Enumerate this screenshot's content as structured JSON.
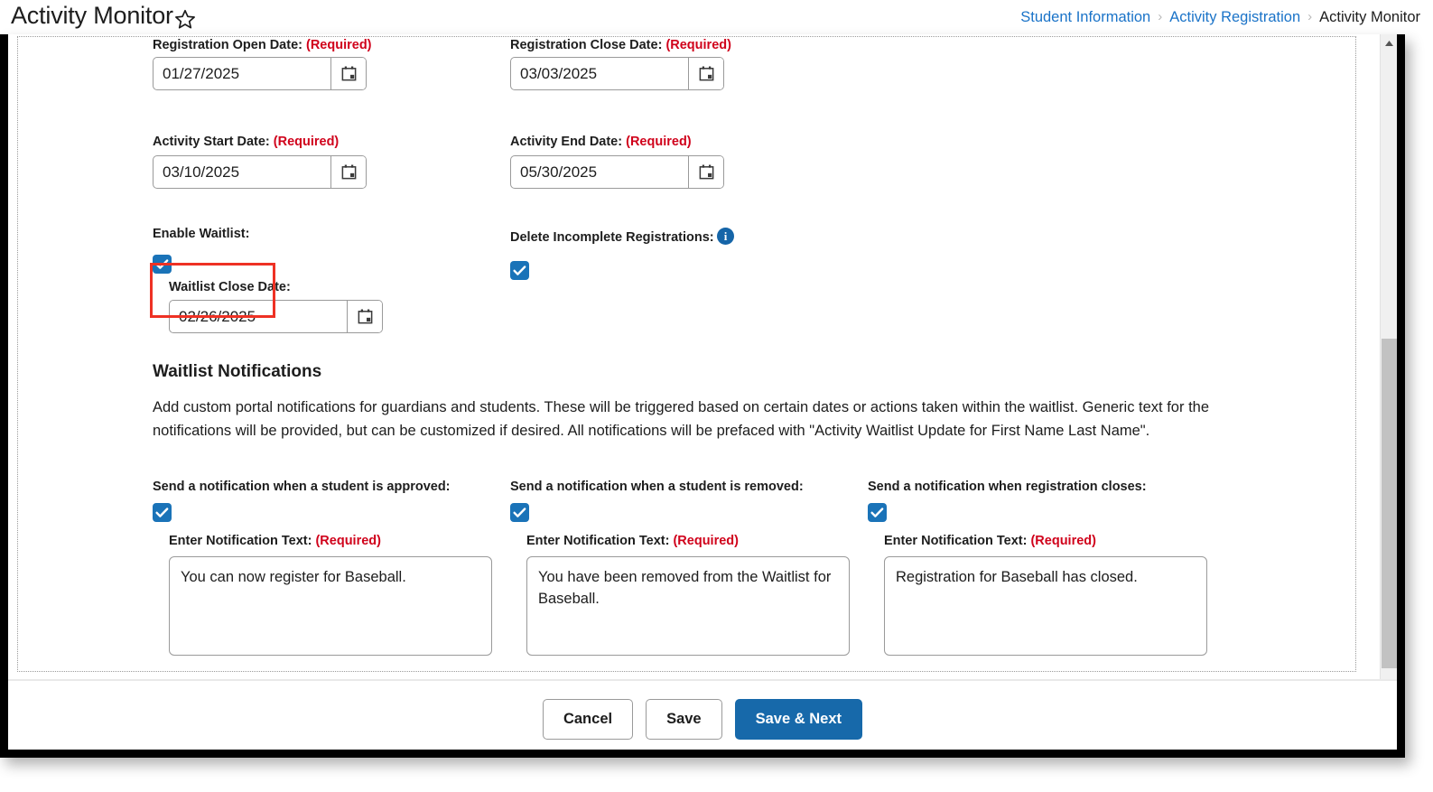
{
  "header": {
    "title": "Activity Monitor",
    "favorite_icon": "star-outline-icon",
    "breadcrumb": [
      {
        "label": "Student Information",
        "current": false
      },
      {
        "label": "Activity Registration",
        "current": false
      },
      {
        "label": "Activity Monitor",
        "current": true
      }
    ],
    "breadcrumb_separator": "›"
  },
  "form": {
    "registration_open": {
      "label": "Registration Open Date:",
      "required_text": "(Required)",
      "value": "01/27/2025",
      "calendar_icon": "calendar-icon"
    },
    "registration_close": {
      "label": "Registration Close Date:",
      "required_text": "(Required)",
      "value": "03/03/2025",
      "calendar_icon": "calendar-icon"
    },
    "activity_start": {
      "label": "Activity Start Date:",
      "required_text": "(Required)",
      "value": "03/10/2025",
      "calendar_icon": "calendar-icon"
    },
    "activity_end": {
      "label": "Activity End Date:",
      "required_text": "(Required)",
      "value": "05/30/2025",
      "calendar_icon": "calendar-icon"
    },
    "enable_waitlist": {
      "label": "Enable Waitlist:",
      "checked": true,
      "highlighted": true
    },
    "delete_incomplete": {
      "label": "Delete Incomplete Registrations:",
      "checked": true,
      "info_icon": "info-icon",
      "info_glyph": "i"
    },
    "waitlist_close": {
      "label": "Waitlist Close Date:",
      "value": "02/26/2025",
      "calendar_icon": "calendar-icon"
    }
  },
  "waitlist_notifications": {
    "heading": "Waitlist Notifications",
    "description": "Add custom portal notifications for guardians and students. These will be triggered based on certain dates or actions taken within the waitlist. Generic text for the notifications will be provided, but can be customized if desired. All notifications will be prefaced with \"Activity Waitlist Update for First Name Last Name\".",
    "columns": [
      {
        "title": "Send a notification when a student is approved:",
        "checked": true,
        "text_label": "Enter Notification Text:",
        "required_text": "(Required)",
        "text_value": "You can now register for Baseball."
      },
      {
        "title": "Send a notification when a student is removed:",
        "checked": true,
        "text_label": "Enter Notification Text:",
        "required_text": "(Required)",
        "text_value": "You have been removed from the Waitlist for Baseball."
      },
      {
        "title": "Send a notification when registration closes:",
        "checked": true,
        "text_label": "Enter Notification Text:",
        "required_text": "(Required)",
        "text_value": "Registration for Baseball has closed."
      }
    ]
  },
  "footer": {
    "cancel_label": "Cancel",
    "save_label": "Save",
    "save_next_label": "Save & Next"
  },
  "scrollbar": {
    "up_arrow_icon": "chevron-up-icon"
  },
  "colors": {
    "link": "#1a73c8",
    "required": "#d0021b",
    "checkbox": "#1a73b8",
    "primary_button": "#1769aa",
    "annotation": "#ee3124"
  }
}
